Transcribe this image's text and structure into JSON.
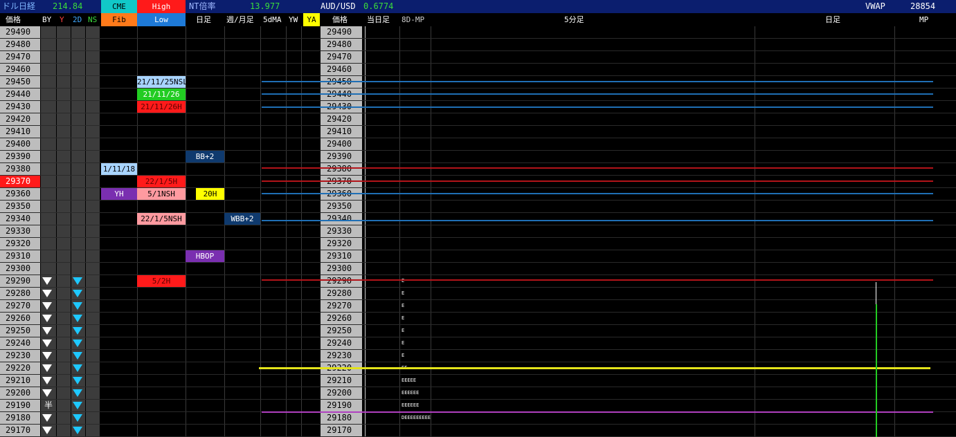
{
  "header": {
    "dollar_nikkei_label": "ドル日経",
    "dollar_nikkei_value": "214.84",
    "cme_label": "CME",
    "high_label": "High",
    "nt_label": "NT倍率",
    "nt_value": "13.977",
    "audusd_label": "AUD/USD",
    "audusd_value": "0.6774",
    "vwap_label": "VWAP",
    "vwap_value": "28854"
  },
  "subheader": {
    "price_label": "価格",
    "by": "BY",
    "y": "Y",
    "d2": "2D",
    "ns": "NS",
    "fib": "Fib",
    "low": "Low",
    "daily": "日足",
    "weekly_monthly": "週/月足",
    "ma5d": "5dMA",
    "yw": "YW",
    "ya": "YA",
    "price_label2": "価格",
    "today_daily": "当日足",
    "mp8d": "8D-MP",
    "min5": "5分足",
    "daily2": "日足",
    "mp": "MP"
  },
  "prices": [
    "29490",
    "29480",
    "29470",
    "29460",
    "29450",
    "29440",
    "29430",
    "29420",
    "29410",
    "29400",
    "29390",
    "29380",
    "29370",
    "29360",
    "29350",
    "29340",
    "29330",
    "29320",
    "29310",
    "29300",
    "29290",
    "29280",
    "29270",
    "29260",
    "29250",
    "29240",
    "29230",
    "29220",
    "29210",
    "29200",
    "29190",
    "29180",
    "29170"
  ],
  "highlight_price": "29370",
  "half_marker": "半",
  "tags": {
    "fib_1": "1/11/18",
    "fib_yh": "YH",
    "hl_a": "21/11/25NSL",
    "hl_b": "21/11/26",
    "hl_c": "21/11/26H",
    "hl_d": "22/1/5H",
    "hl_e": "5/1NSH",
    "hl_f": "22/1/5NSH",
    "hl_g": "5/2H",
    "d_bb": "BB+2",
    "d_20h": "20H",
    "d_hbop": "HBOP",
    "w_bb": "WBB+2"
  },
  "mp_rows": [
    "E",
    "E",
    "E",
    "E",
    "E",
    "E",
    "E",
    "EE",
    "EEEEE",
    "EEEEEE",
    "EEEEEE",
    "DEEEEEEEEE"
  ],
  "colors": {
    "header_bg": "#0b1e6e",
    "price_bg": "#bdbdbd",
    "highlight": "#ff1a1a",
    "blue_line": "#1f6fb5",
    "red_line": "#b3141a",
    "yellow_line": "#e3e31a",
    "magenta_line": "#b040c0",
    "green_bar": "#22cc22"
  }
}
